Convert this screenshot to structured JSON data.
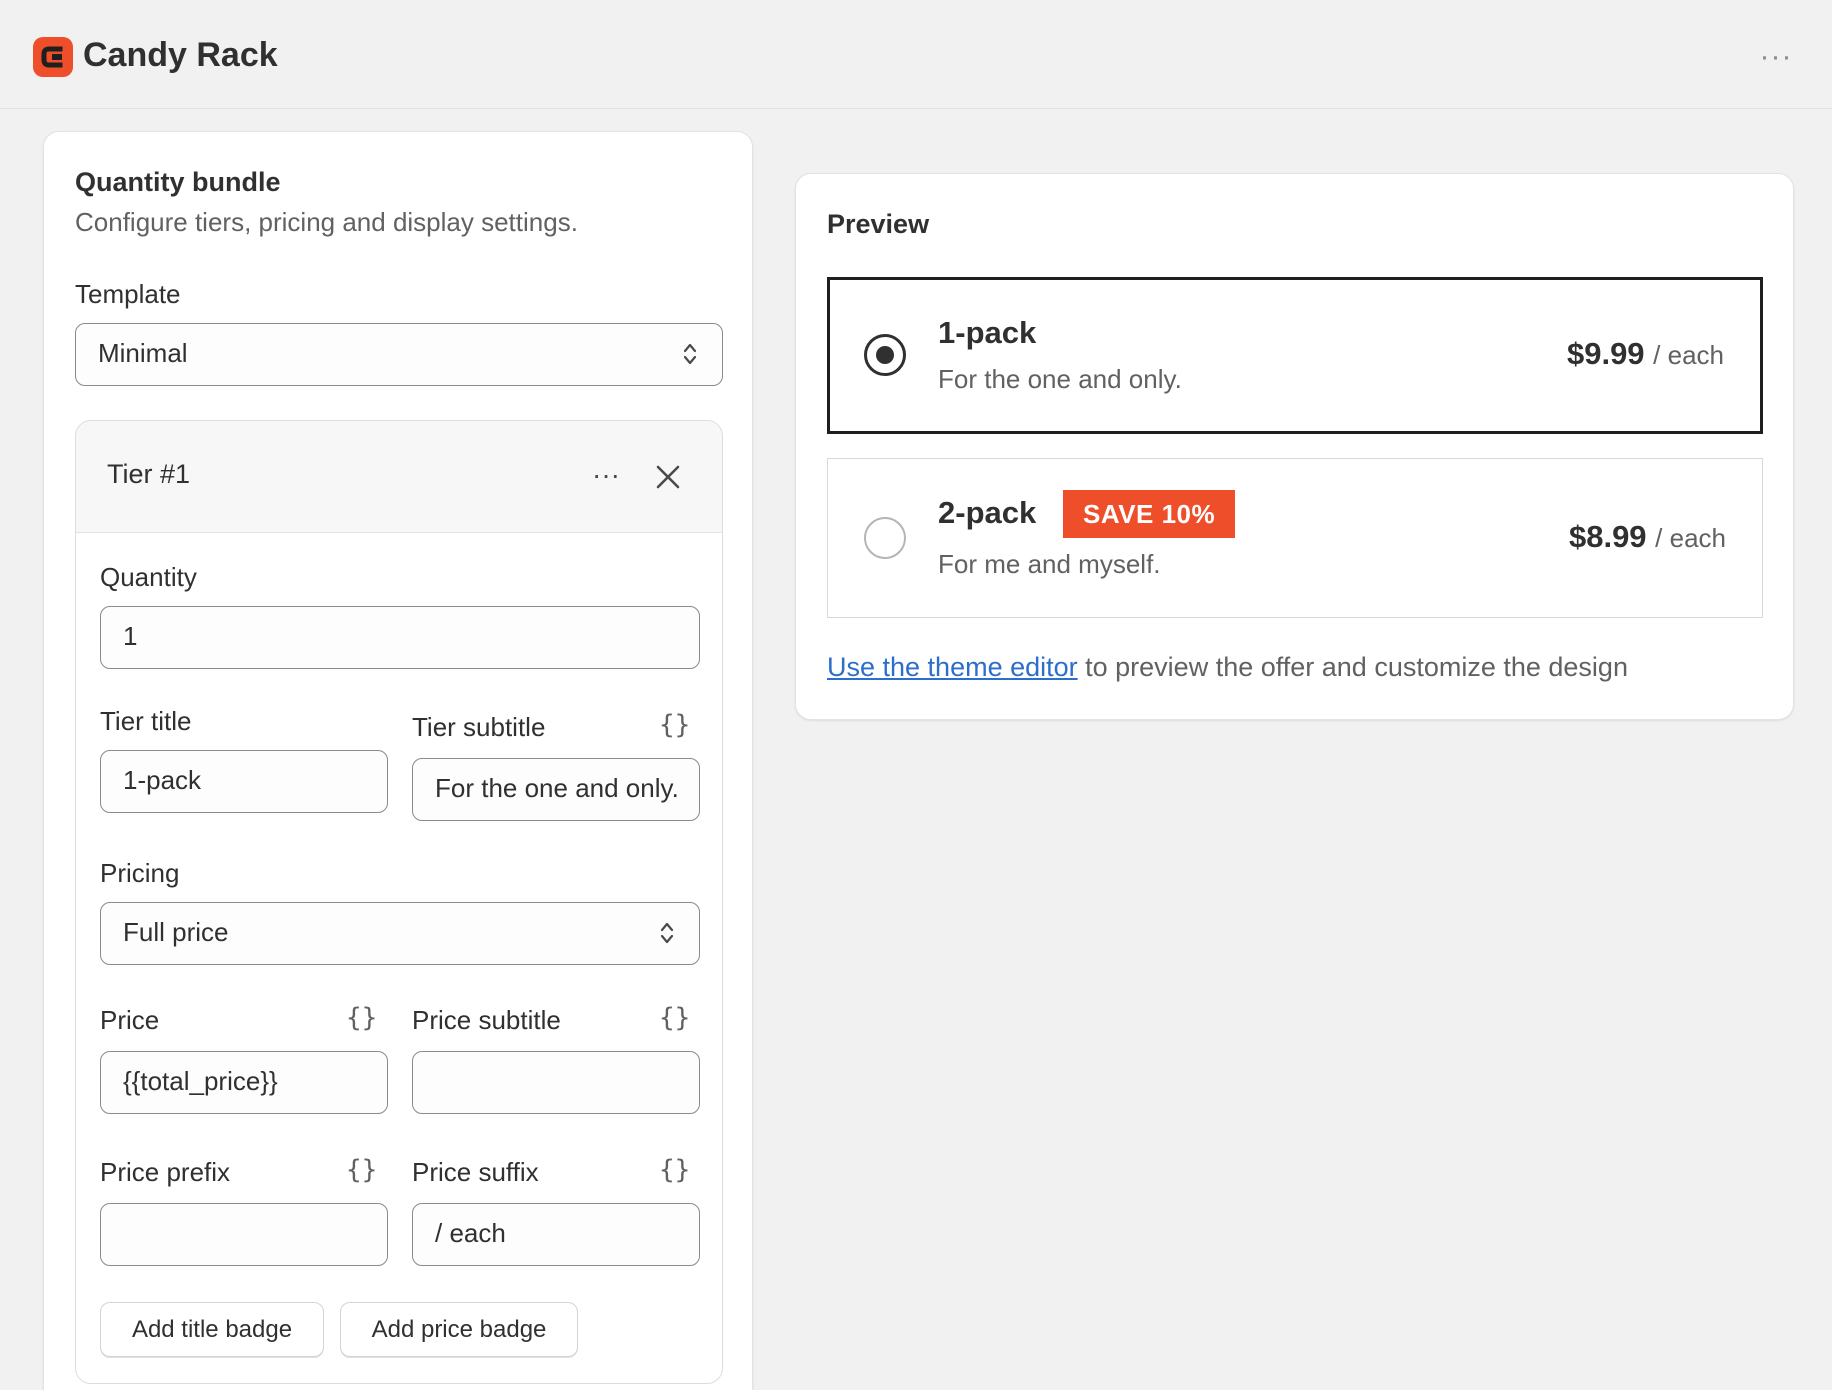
{
  "app": {
    "title": "Candy Rack",
    "more_icon": "ellipsis-icon"
  },
  "colors": {
    "brand": "#ef4e2b",
    "badge": "#ef4e2b",
    "link": "#2c6ecb"
  },
  "bundle": {
    "title": "Quantity bundle",
    "subtitle": "Configure tiers, pricing and display settings.",
    "template_label": "Template",
    "template_value": "Minimal"
  },
  "tier": {
    "header": "Tier #1",
    "quantity_label": "Quantity",
    "quantity_value": "1",
    "title_label": "Tier title",
    "title_value": "1-pack",
    "subtitle_label": "Tier subtitle",
    "subtitle_value": "For the one and only.",
    "pricing_label": "Pricing",
    "pricing_value": "Full price",
    "price_label": "Price",
    "price_value": "{{total_price}}",
    "price_subtitle_label": "Price subtitle",
    "price_subtitle_value": "",
    "price_prefix_label": "Price prefix",
    "price_prefix_value": "",
    "price_suffix_label": "Price suffix",
    "price_suffix_value": "/ each",
    "add_title_badge": "Add title badge",
    "add_price_badge": "Add price badge",
    "braces_glyph": "{}"
  },
  "preview": {
    "title": "Preview",
    "options": [
      {
        "title": "1-pack",
        "subtitle": "For the one and only.",
        "price": "$9.99",
        "suffix": "/ each",
        "selected": true
      },
      {
        "title": "2-pack",
        "badge": "SAVE 10%",
        "subtitle": "For me and myself.",
        "price": "$8.99",
        "suffix": "/ each",
        "selected": false
      }
    ],
    "link_text": "Use the theme editor",
    "footer_rest": " to preview the offer and customize the design"
  }
}
